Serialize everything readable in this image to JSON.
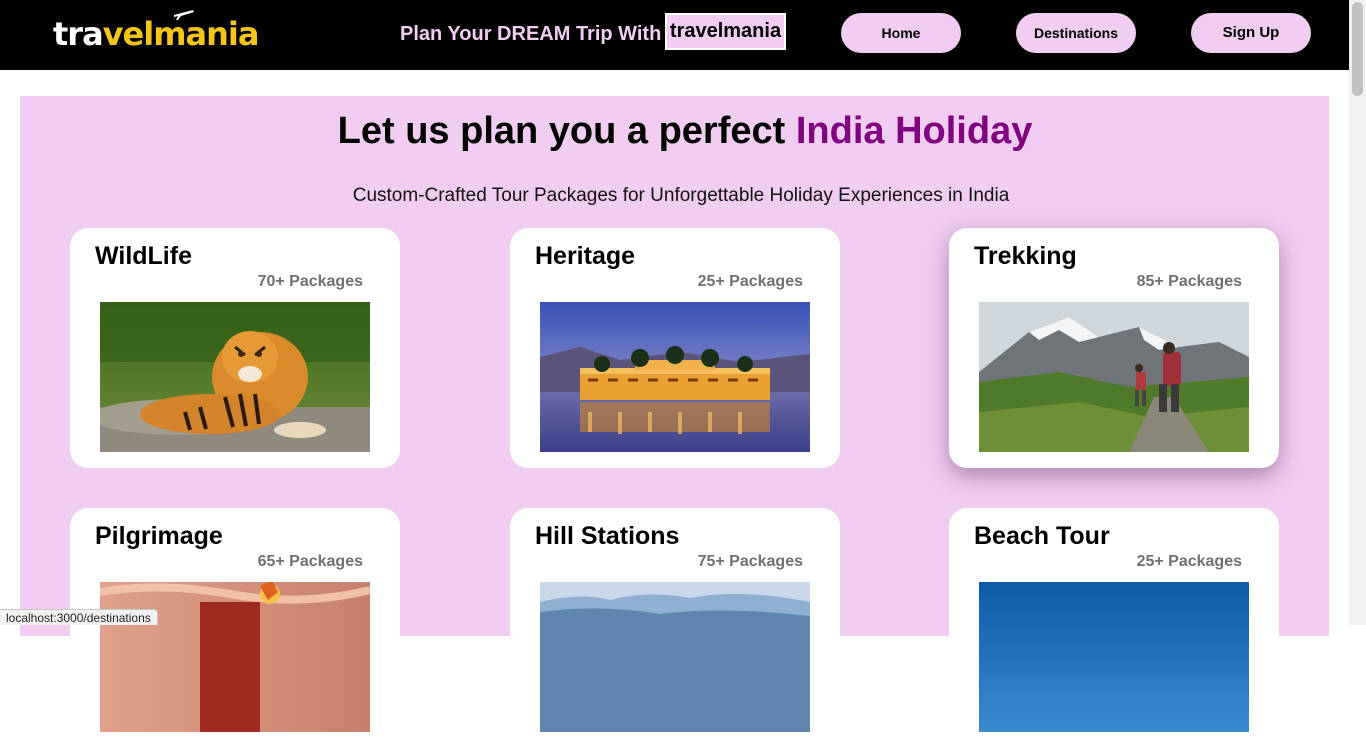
{
  "header": {
    "logo": {
      "part1": "tra",
      "part2": "vel",
      "part3": "mania"
    },
    "tagline": "Plan Your DREAM Trip With",
    "tagline_brand": "travelmania",
    "nav": {
      "home": "Home",
      "destinations": "Destinations",
      "sign_up": "Sign Up"
    }
  },
  "main": {
    "heading": "Let us plan you a perfect",
    "heading_accent": "India Holiday",
    "subheading": "Custom-Crafted Tour Packages for Unforgettable Holiday Experiences in India",
    "cards": [
      {
        "title": "WildLife",
        "count": "70+ Packages",
        "image": "tiger-photo"
      },
      {
        "title": "Heritage",
        "count": "25+ Packages",
        "image": "palace-on-lake-photo"
      },
      {
        "title": "Trekking",
        "count": "85+ Packages",
        "image": "hikers-mountain-photo"
      },
      {
        "title": "Pilgrimage",
        "count": "65+ Packages",
        "image": "temple-aarti-photo"
      },
      {
        "title": "Hill Stations",
        "count": "75+ Packages",
        "image": "hills-photo"
      },
      {
        "title": "Beach Tour",
        "count": "25+ Packages",
        "image": "beach-photo"
      }
    ]
  },
  "status_url": "localhost:3000/destinations",
  "colors": {
    "accent": "#800080",
    "panel": "#f0cdf1",
    "nav_bg": "#000000",
    "logo_yellow": "#f5c518",
    "count_gray": "#707070"
  }
}
